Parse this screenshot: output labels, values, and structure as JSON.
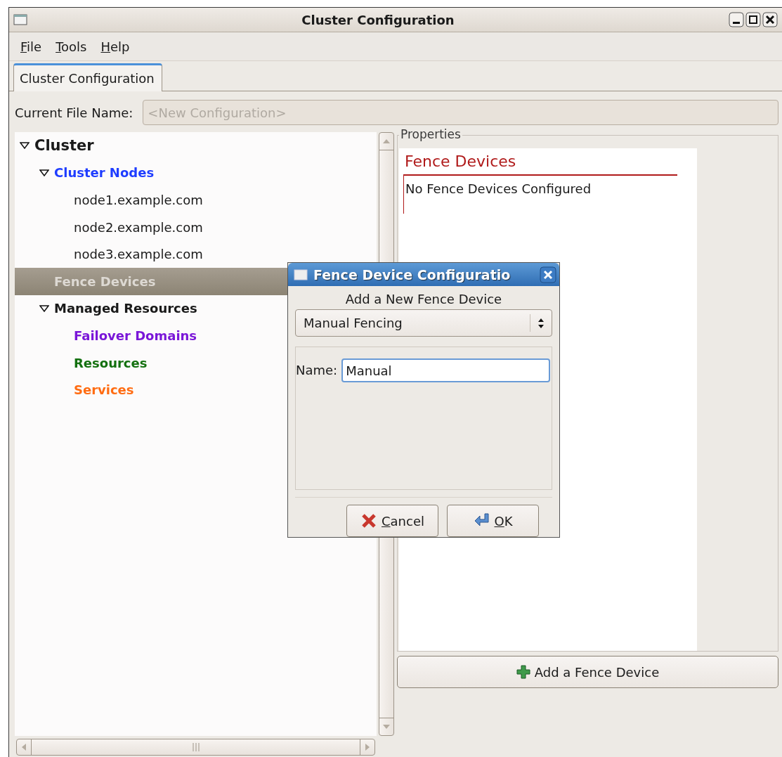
{
  "window": {
    "title": "Cluster Configuration"
  },
  "menu": [
    "File",
    "Tools",
    "Help"
  ],
  "tabs": [
    {
      "label": "Cluster Configuration",
      "selected": true
    }
  ],
  "file_name": {
    "label": "Current File Name:",
    "value": "<New Configuration>",
    "disabled": true
  },
  "tree": [
    {
      "label": "Cluster",
      "kind": "root",
      "expanded": true,
      "selected": false,
      "children": [
        {
          "label": "Cluster Nodes",
          "kind": "section",
          "color": "#1f3dff",
          "expanded": true,
          "selected": false,
          "children": [
            {
              "label": "node1.example.com",
              "kind": "host",
              "selected": false
            },
            {
              "label": "node2.example.com",
              "kind": "host",
              "selected": false
            },
            {
              "label": "node3.example.com",
              "kind": "host",
              "selected": false
            }
          ]
        },
        {
          "label": "Fence Devices",
          "kind": "section",
          "selected": true
        },
        {
          "label": "Managed Resources",
          "kind": "section",
          "expanded": true,
          "selected": false,
          "children": [
            {
              "label": "Failover Domains",
              "kind": "section",
              "color": "#7a16d8",
              "selected": false
            },
            {
              "label": "Resources",
              "kind": "section",
              "color": "#13700f",
              "selected": false
            },
            {
              "label": "Services",
              "kind": "section",
              "color": "#ff6c12",
              "selected": false
            }
          ]
        }
      ]
    }
  ],
  "properties": {
    "frame_label": "Properties",
    "heading": "Fence Devices",
    "message": "No Fence Devices Configured"
  },
  "add_button": "Add a Fence Device",
  "dialog": {
    "title": "Fence Device Configuratio",
    "heading": "Add a New Fence Device",
    "device_type": "Manual Fencing",
    "name_label": "Name:",
    "name_value": "Manual",
    "buttons": [
      {
        "label": "Cancel",
        "kind": "cancel"
      },
      {
        "label": "OK",
        "kind": "ok"
      }
    ]
  }
}
